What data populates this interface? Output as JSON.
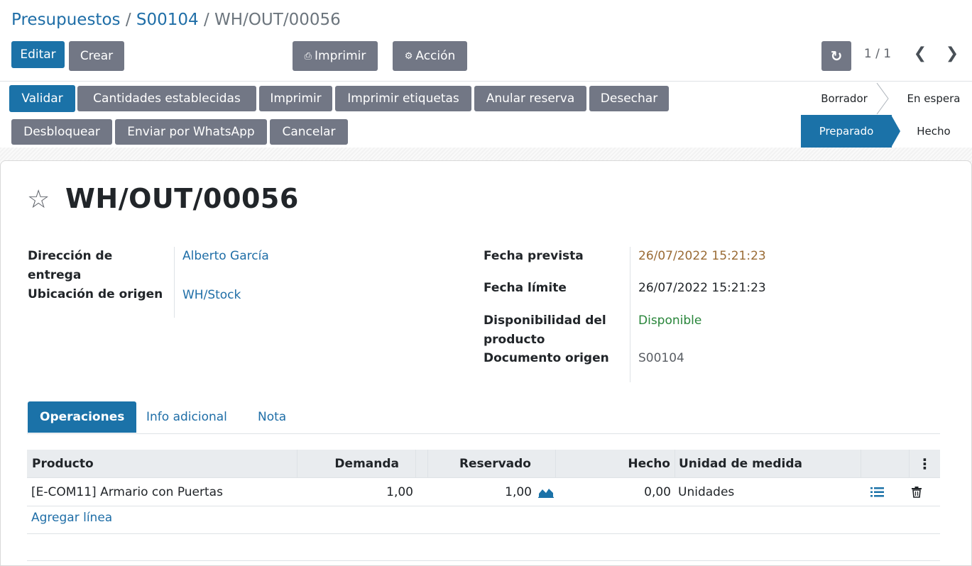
{
  "breadcrumb": {
    "items": [
      "Presupuestos",
      "S00104"
    ],
    "separator": "/",
    "current": "WH/OUT/00056"
  },
  "toolbar": {
    "edit_label": "Editar",
    "create_label": "Crear",
    "print_label": "Imprimir",
    "action_label": "Acción"
  },
  "pager": {
    "value": "1 / 1"
  },
  "statusbar": {
    "buttons": [
      "Validar",
      "Cantidades establecidas",
      "Imprimir",
      "Imprimir etiquetas",
      "Anular reserva",
      "Desechar",
      "Desbloquear",
      "Enviar por WhatsApp",
      "Cancelar"
    ],
    "stages": [
      "Borrador",
      "En espera",
      "Preparado",
      "Hecho"
    ],
    "active_stage": "Preparado"
  },
  "record": {
    "title": "WH/OUT/00056"
  },
  "fields_left": {
    "delivery_address_label": "Dirección de entrega",
    "delivery_address_value": "Alberto García",
    "source_location_label": "Ubicación de origen",
    "source_location_value": "WH/Stock"
  },
  "fields_right": {
    "scheduled_date_label": "Fecha prevista",
    "scheduled_date_value": "26/07/2022 15:21:23",
    "deadline_label": "Fecha límite",
    "deadline_value": "26/07/2022 15:21:23",
    "availability_label": "Disponibilidad del producto",
    "availability_value": "Disponible",
    "source_document_label": "Documento origen",
    "source_document_value": "S00104"
  },
  "tabs": [
    "Operaciones",
    "Info adicional",
    "Nota"
  ],
  "active_tab": "Operaciones",
  "table": {
    "columns": [
      "Producto",
      "Demanda",
      "Reservado",
      "Hecho",
      "Unidad de medida"
    ],
    "rows": [
      {
        "product": "[E-COM11] Armario con Puertas",
        "demand": "1,00",
        "reserved": "1,00",
        "done": "0,00",
        "uom": "Unidades"
      }
    ],
    "add_line_label": "Agregar línea"
  },
  "colors": {
    "primary": "#1b72a8",
    "secondary": "#727785",
    "link": "#1f6ea7",
    "date_warning": "#9a6b35",
    "success": "#28853a"
  },
  "icons": [
    "print-icon",
    "gear-icon",
    "refresh-icon",
    "chevron-left-icon",
    "chevron-right-icon",
    "star-icon",
    "area-chart-icon",
    "list-icon",
    "trash-icon",
    "vertical-dots-icon"
  ]
}
